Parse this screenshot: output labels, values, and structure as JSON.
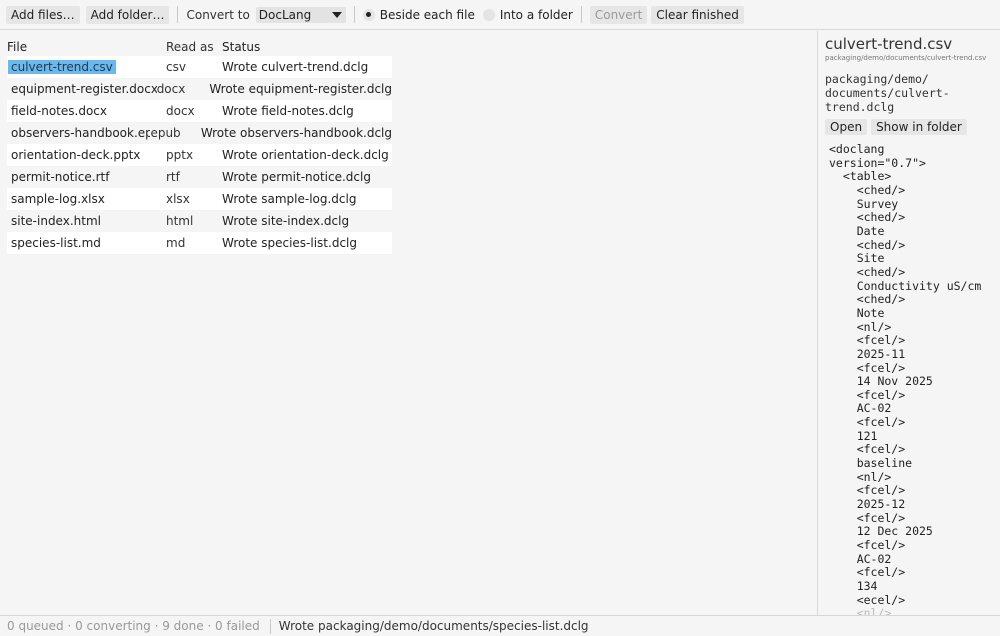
{
  "toolbar": {
    "add_files": "Add files…",
    "add_folder": "Add folder…",
    "convert_to_label": "Convert to",
    "format_value": "DocLang",
    "radio_beside": "Beside each file",
    "radio_into": "Into a folder",
    "convert": "Convert",
    "clear_finished": "Clear finished"
  },
  "table": {
    "headers": {
      "file": "File",
      "read_as": "Read as",
      "status": "Status"
    },
    "rows": [
      {
        "file": "culvert-trend.csv",
        "read_as": "csv",
        "status": "Wrote culvert-trend.dclg"
      },
      {
        "file": "equipment-register.docx",
        "read_as": "docx",
        "status": "Wrote equipment-register.dclg"
      },
      {
        "file": "field-notes.docx",
        "read_as": "docx",
        "status": "Wrote field-notes.dclg"
      },
      {
        "file": "observers-handbook.epub",
        "read_as": "epub",
        "status": "Wrote observers-handbook.dclg"
      },
      {
        "file": "orientation-deck.pptx",
        "read_as": "pptx",
        "status": "Wrote orientation-deck.dclg"
      },
      {
        "file": "permit-notice.rtf",
        "read_as": "rtf",
        "status": "Wrote permit-notice.dclg"
      },
      {
        "file": "sample-log.xlsx",
        "read_as": "xlsx",
        "status": "Wrote sample-log.dclg"
      },
      {
        "file": "site-index.html",
        "read_as": "html",
        "status": "Wrote site-index.dclg"
      },
      {
        "file": "species-list.md",
        "read_as": "md",
        "status": "Wrote species-list.dclg"
      }
    ]
  },
  "preview": {
    "title": "culvert-trend.csv",
    "subtitle": "packaging/demo/documents/culvert-trend.csv",
    "output_path": "packaging/demo/\ndocuments/culvert-\ntrend.dclg",
    "open": "Open",
    "show_in_folder": "Show in folder",
    "code": "<doclang\nversion=\"0.7\">\n  <table>\n    <ched/>\n    Survey\n    <ched/>\n    Date\n    <ched/>\n    Site\n    <ched/>\n    Conductivity uS/cm\n    <ched/>\n    Note\n    <nl/>\n    <fcel/>\n    2025-11\n    <fcel/>\n    14 Nov 2025\n    <fcel/>\n    AC-02\n    <fcel/>\n    121\n    <fcel/>\n    baseline\n    <nl/>\n    <fcel/>\n    2025-12\n    <fcel/>\n    12 Dec 2025\n    <fcel/>\n    AC-02\n    <fcel/>\n    134\n    <ecel/>",
    "code_tail": "    <nl/>"
  },
  "status": {
    "counts": "0 queued · 0 converting · 9 done · 0 failed",
    "message": "Wrote packaging/demo/documents/species-list.dclg"
  }
}
